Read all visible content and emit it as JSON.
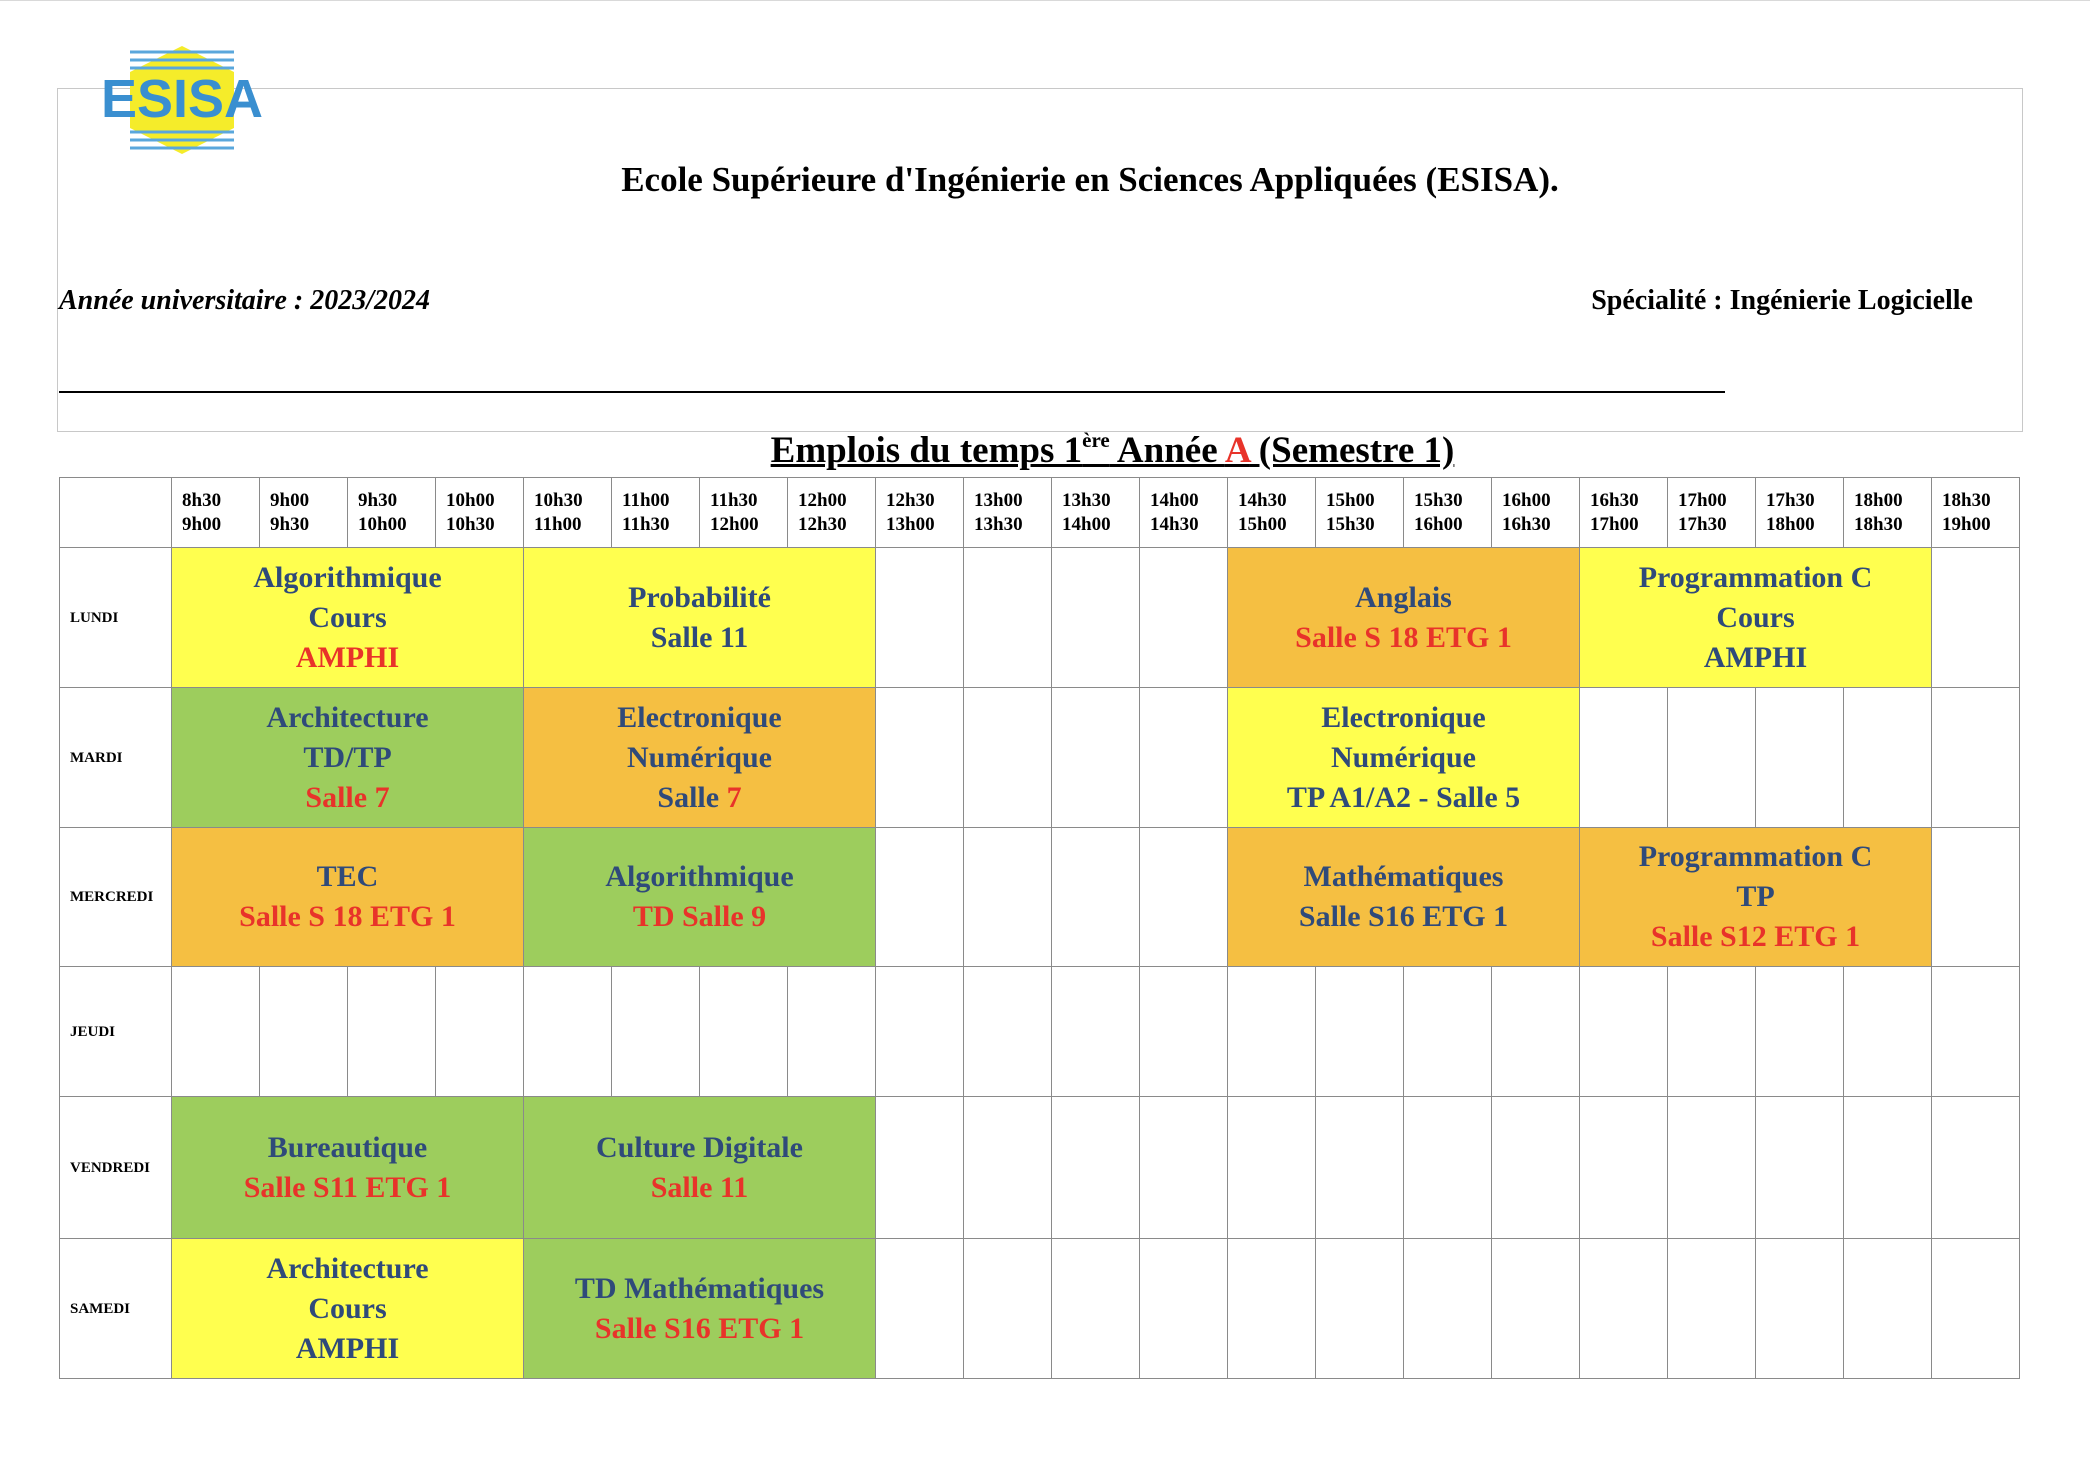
{
  "logo": {
    "text": "ESISA"
  },
  "header": {
    "school": "Ecole Supérieure d'Ingénierie en Sciences Appliquées (ESISA).",
    "year": "Année universitaire : 2023/2024",
    "specialty": "Spécialité : Ingénierie Logicielle"
  },
  "title": {
    "part1": "Emplois du temps 1",
    "sup": "ère",
    "part2": " Année ",
    "group": "A",
    "part3": " (Semestre 1)"
  },
  "colors": {
    "blue_text": "#2f4a7a",
    "red_text": "#e8332a",
    "yellow": "#ffff4f",
    "green": "#9dcd5d",
    "orange": "#f5bf42"
  },
  "time_slots": [
    {
      "start": "8h30",
      "end": "9h00"
    },
    {
      "start": "9h00",
      "end": "9h30"
    },
    {
      "start": "9h30",
      "end": "10h00"
    },
    {
      "start": "10h00",
      "end": "10h30"
    },
    {
      "start": "10h30",
      "end": "11h00"
    },
    {
      "start": "11h00",
      "end": "11h30"
    },
    {
      "start": "11h30",
      "end": "12h00"
    },
    {
      "start": "12h00",
      "end": "12h30"
    },
    {
      "start": "12h30",
      "end": "13h00"
    },
    {
      "start": "13h00",
      "end": "13h30"
    },
    {
      "start": "13h30",
      "end": "14h00"
    },
    {
      "start": "14h00",
      "end": "14h30"
    },
    {
      "start": "14h30",
      "end": "15h00"
    },
    {
      "start": "15h00",
      "end": "15h30"
    },
    {
      "start": "15h30",
      "end": "16h00"
    },
    {
      "start": "16h00",
      "end": "16h30"
    },
    {
      "start": "16h30",
      "end": "17h00"
    },
    {
      "start": "17h00",
      "end": "17h30"
    },
    {
      "start": "17h30",
      "end": "18h00"
    },
    {
      "start": "18h00",
      "end": "18h30"
    },
    {
      "start": "18h30",
      "end": "19h00"
    }
  ],
  "days": [
    {
      "label": "LUNDI",
      "courses": [
        {
          "lines": [
            {
              "text": "Algorithmique",
              "color": "blue"
            },
            {
              "text": "Cours",
              "color": "blue"
            },
            {
              "text": "AMPHI",
              "color": "red"
            }
          ]
        },
        {
          "lines": [
            {
              "text": "Probabilité",
              "color": "blue"
            },
            {
              "text": "Salle 11",
              "color": "blue"
            }
          ]
        },
        {
          "lines": [
            {
              "text": "Anglais",
              "color": "blue"
            },
            {
              "text": "Salle S 18 ETG 1",
              "color": "red"
            }
          ]
        },
        {
          "lines": [
            {
              "text": "Programmation C",
              "color": "blue"
            },
            {
              "text": "Cours",
              "color": "blue"
            },
            {
              "text": "AMPHI",
              "color": "blue"
            }
          ]
        }
      ]
    },
    {
      "label": "MARDI",
      "courses": [
        {
          "lines": [
            {
              "text": "Architecture",
              "color": "blue"
            },
            {
              "text": "TD/TP",
              "color": "blue"
            },
            {
              "text": "Salle 7",
              "color": "red"
            }
          ]
        },
        {
          "lines": [
            {
              "text": "Electronique",
              "color": "blue"
            },
            {
              "text": "Numérique",
              "color": "blue"
            },
            {
              "text": "Salle ",
              "color": "blue",
              "tail": "7"
            }
          ]
        },
        {
          "lines": [
            {
              "text": "Electronique",
              "color": "blue"
            },
            {
              "text": "Numérique",
              "color": "blue"
            },
            {
              "text": "TP A1/A2 - Salle 5",
              "color": "blue"
            }
          ]
        }
      ]
    },
    {
      "label": "MERCREDI",
      "courses": [
        {
          "lines": [
            {
              "text": "TEC",
              "color": "blue"
            },
            {
              "text": "Salle S 18 ETG 1",
              "color": "red"
            }
          ]
        },
        {
          "lines": [
            {
              "text": "Algorithmique",
              "color": "blue"
            },
            {
              "text": "TD Salle 9",
              "color": "red"
            }
          ]
        },
        {
          "lines": [
            {
              "text": "Mathématiques",
              "color": "blue"
            },
            {
              "text": "Salle S16 ETG 1",
              "color": "blue"
            }
          ]
        },
        {
          "lines": [
            {
              "text": "Programmation C",
              "color": "blue"
            },
            {
              "text": "TP",
              "color": "blue"
            },
            {
              "text": "Salle S12 ETG 1",
              "color": "red"
            }
          ]
        }
      ]
    },
    {
      "label": "JEUDI",
      "courses": []
    },
    {
      "label": "VENDREDI",
      "courses": [
        {
          "lines": [
            {
              "text": "Bureautique",
              "color": "blue"
            },
            {
              "text": "Salle S11 ETG 1",
              "color": "red"
            }
          ]
        },
        {
          "lines": [
            {
              "text": "Culture Digitale",
              "color": "blue"
            },
            {
              "text": "Salle 11",
              "color": "red"
            }
          ]
        }
      ]
    },
    {
      "label": "SAMEDI",
      "courses": [
        {
          "lines": [
            {
              "text": "Architecture",
              "color": "blue"
            },
            {
              "text": "Cours",
              "color": "blue"
            },
            {
              "text": "AMPHI",
              "color": "blue"
            }
          ]
        },
        {
          "lines": [
            {
              "text": "TD Mathématiques",
              "color": "blue"
            },
            {
              "text": "Salle S16 ETG 1",
              "color": "red"
            }
          ]
        }
      ]
    }
  ]
}
